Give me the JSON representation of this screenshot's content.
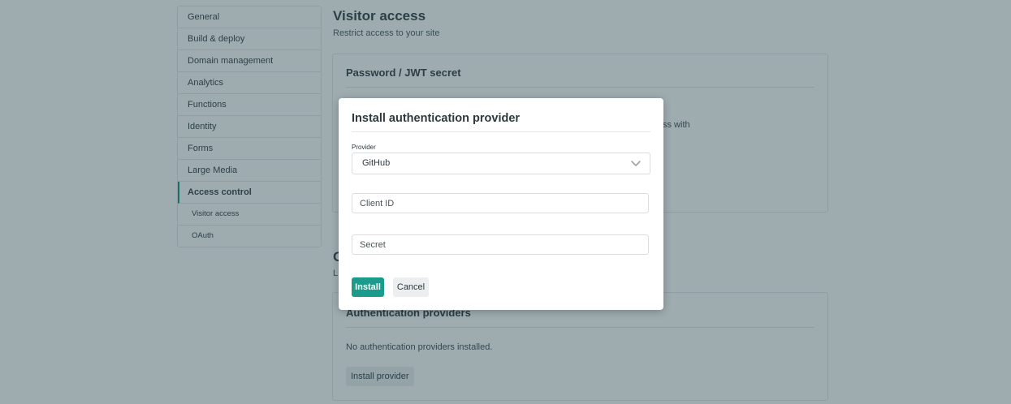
{
  "sidebar": {
    "items": [
      {
        "label": "General"
      },
      {
        "label": "Build & deploy"
      },
      {
        "label": "Domain management"
      },
      {
        "label": "Analytics"
      },
      {
        "label": "Functions"
      },
      {
        "label": "Identity"
      },
      {
        "label": "Forms"
      },
      {
        "label": "Large Media"
      },
      {
        "label": "Access control"
      },
      {
        "label": "Visitor access"
      },
      {
        "label": "OAuth"
      }
    ]
  },
  "main": {
    "title": "Visitor access",
    "subtitle": "Restrict access to your site",
    "password_card": {
      "title": "Password / JWT secret",
      "text_fragment": "ss with"
    },
    "oauth_section": {
      "title_fragment": "O",
      "subtitle_fragment": "L"
    },
    "providers_card": {
      "title": "Authentication providers",
      "empty_text": "No authentication providers installed.",
      "install_button": "Install provider"
    }
  },
  "modal": {
    "title": "Install authentication provider",
    "provider_label": "Provider",
    "provider_value": "GitHub",
    "client_id_placeholder": "Client ID",
    "secret_placeholder": "Secret",
    "install_label": "Install",
    "cancel_label": "Cancel"
  },
  "colors": {
    "accent": "#1a9b8c",
    "overlay": "rgba(40, 70, 80, 0.45)"
  },
  "icons": {
    "provider_dropdown": "chevron-down-icon"
  }
}
